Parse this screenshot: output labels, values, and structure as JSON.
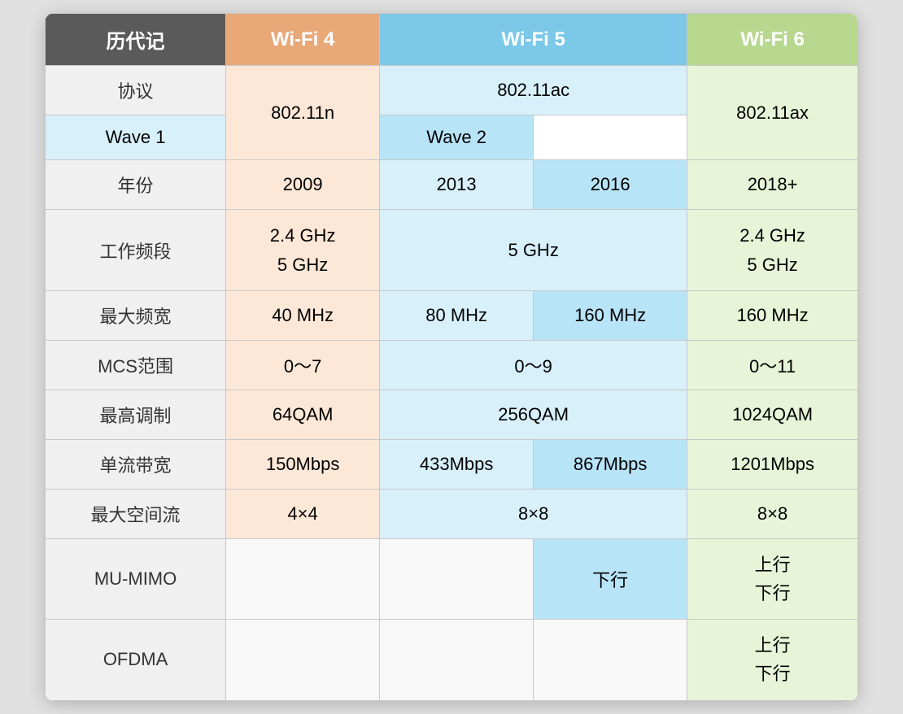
{
  "header": {
    "col_label": "历代记",
    "col_wifi4": "Wi-Fi 4",
    "col_wifi5": "Wi-Fi 5",
    "col_wifi6": "Wi-Fi 6"
  },
  "subheader": {
    "protocol_label": "802.11ac",
    "wave1": "Wave 1",
    "wave2": "Wave 2"
  },
  "rows": [
    {
      "label": "协议",
      "wifi4": "802.11n",
      "wifi5_wave1": "Wave 1",
      "wifi5_wave2": "Wave 2",
      "wifi5_merged": "802.11ac",
      "wifi6": "802.11ax"
    },
    {
      "label": "年份",
      "wifi4": "2009",
      "wifi5_wave1": "2013",
      "wifi5_wave2": "2016",
      "wifi6": "2018+"
    },
    {
      "label": "工作频段",
      "wifi4": "2.4 GHz\n5 GHz",
      "wifi5_merged": "5 GHz",
      "wifi6": "2.4 GHz\n5 GHz"
    },
    {
      "label": "最大频宽",
      "wifi4": "40 MHz",
      "wifi5_wave1": "80 MHz",
      "wifi5_wave2": "160 MHz",
      "wifi6": "160 MHz"
    },
    {
      "label": "MCS范围",
      "wifi4": "0～7",
      "wifi5_merged": "0～9",
      "wifi6": "0～11"
    },
    {
      "label": "最高调制",
      "wifi4": "64QAM",
      "wifi5_merged": "256QAM",
      "wifi6": "1024QAM"
    },
    {
      "label": "单流带宽",
      "wifi4": "150Mbps",
      "wifi5_wave1": "433Mbps",
      "wifi5_wave2": "867Mbps",
      "wifi6": "1201Mbps"
    },
    {
      "label": "最大空间流",
      "wifi4": "4×4",
      "wifi5_merged": "8×8",
      "wifi6": "8×8"
    },
    {
      "label": "MU-MIMO",
      "wifi4": "",
      "wifi5_wave1": "",
      "wifi5_wave2": "下行",
      "wifi6": "上行\n下行"
    },
    {
      "label": "OFDMA",
      "wifi4": "",
      "wifi5_wave1": "",
      "wifi5_wave2": "",
      "wifi6": "上行\n下行"
    }
  ]
}
